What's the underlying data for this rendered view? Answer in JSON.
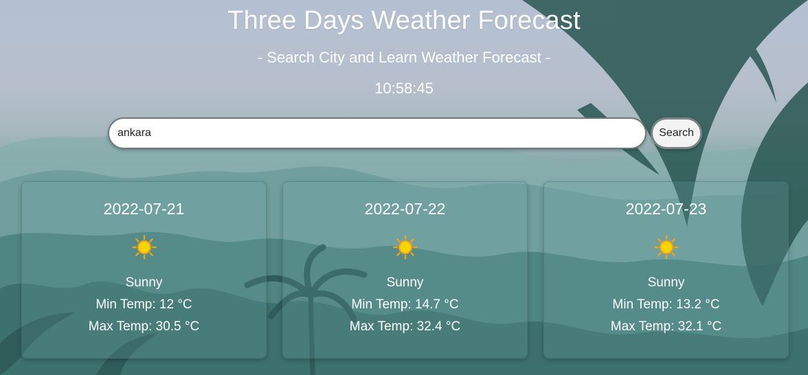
{
  "header": {
    "title": "Three Days Weather Forecast",
    "subtitle": "- Search City and Learn Weather Forecast -",
    "clock": "10:58:45"
  },
  "search": {
    "value": "ankara",
    "button_label": "Search"
  },
  "forecast": [
    {
      "date": "2022-07-21",
      "icon": "sun-icon",
      "condition": "Sunny",
      "min_temp": "Min Temp: 12 °C",
      "max_temp": "Max Temp: 30.5 °C"
    },
    {
      "date": "2022-07-22",
      "icon": "sun-icon",
      "condition": "Sunny",
      "min_temp": "Min Temp: 14.7 °C",
      "max_temp": "Max Temp: 32.4 °C"
    },
    {
      "date": "2022-07-23",
      "icon": "sun-icon",
      "condition": "Sunny",
      "min_temp": "Min Temp: 13.2 °C",
      "max_temp": "Max Temp: 32.1 °C"
    }
  ],
  "colors": {
    "text": "#ffffff",
    "sun_core": "#f7d500",
    "sun_rays": "#f0a21a"
  }
}
